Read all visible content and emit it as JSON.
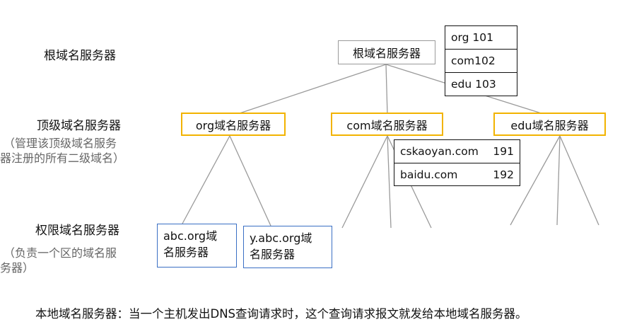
{
  "levels": {
    "root": {
      "title": "根域名服务器"
    },
    "tld": {
      "title": "顶级域名服务器",
      "note_line1": "（管理该顶级域名服务",
      "note_line2": "器注册的所有二级域名）"
    },
    "auth": {
      "title": "权限域名服务器",
      "note_line1": "（负责一个区的域名服",
      "note_line2": "务器）"
    }
  },
  "nodes": {
    "root": "根域名服务器",
    "org": "org域名服务器",
    "com": "com域名服务器",
    "edu": "edu域名服务器",
    "abc_line1": "abc.org域",
    "abc_line2": "名服务器",
    "yabc_line1": "y.abc.org域",
    "yabc_line2": "名服务器"
  },
  "root_table": [
    "org 101",
    "com102",
    "edu 103"
  ],
  "sld_table": [
    {
      "name": "cskaoyan.com",
      "value": "191"
    },
    {
      "name": "baidu.com",
      "value": "192"
    }
  ],
  "footer": "本地域名服务器：当一个主机发出DNS查询请求时，这个查询请求报文就发给本地域名服务器。",
  "colors": {
    "tld_border": "#f2b300",
    "auth_border": "#3a6fc4",
    "root_border": "#9a9a9a",
    "lines": "#9a9a9a"
  }
}
